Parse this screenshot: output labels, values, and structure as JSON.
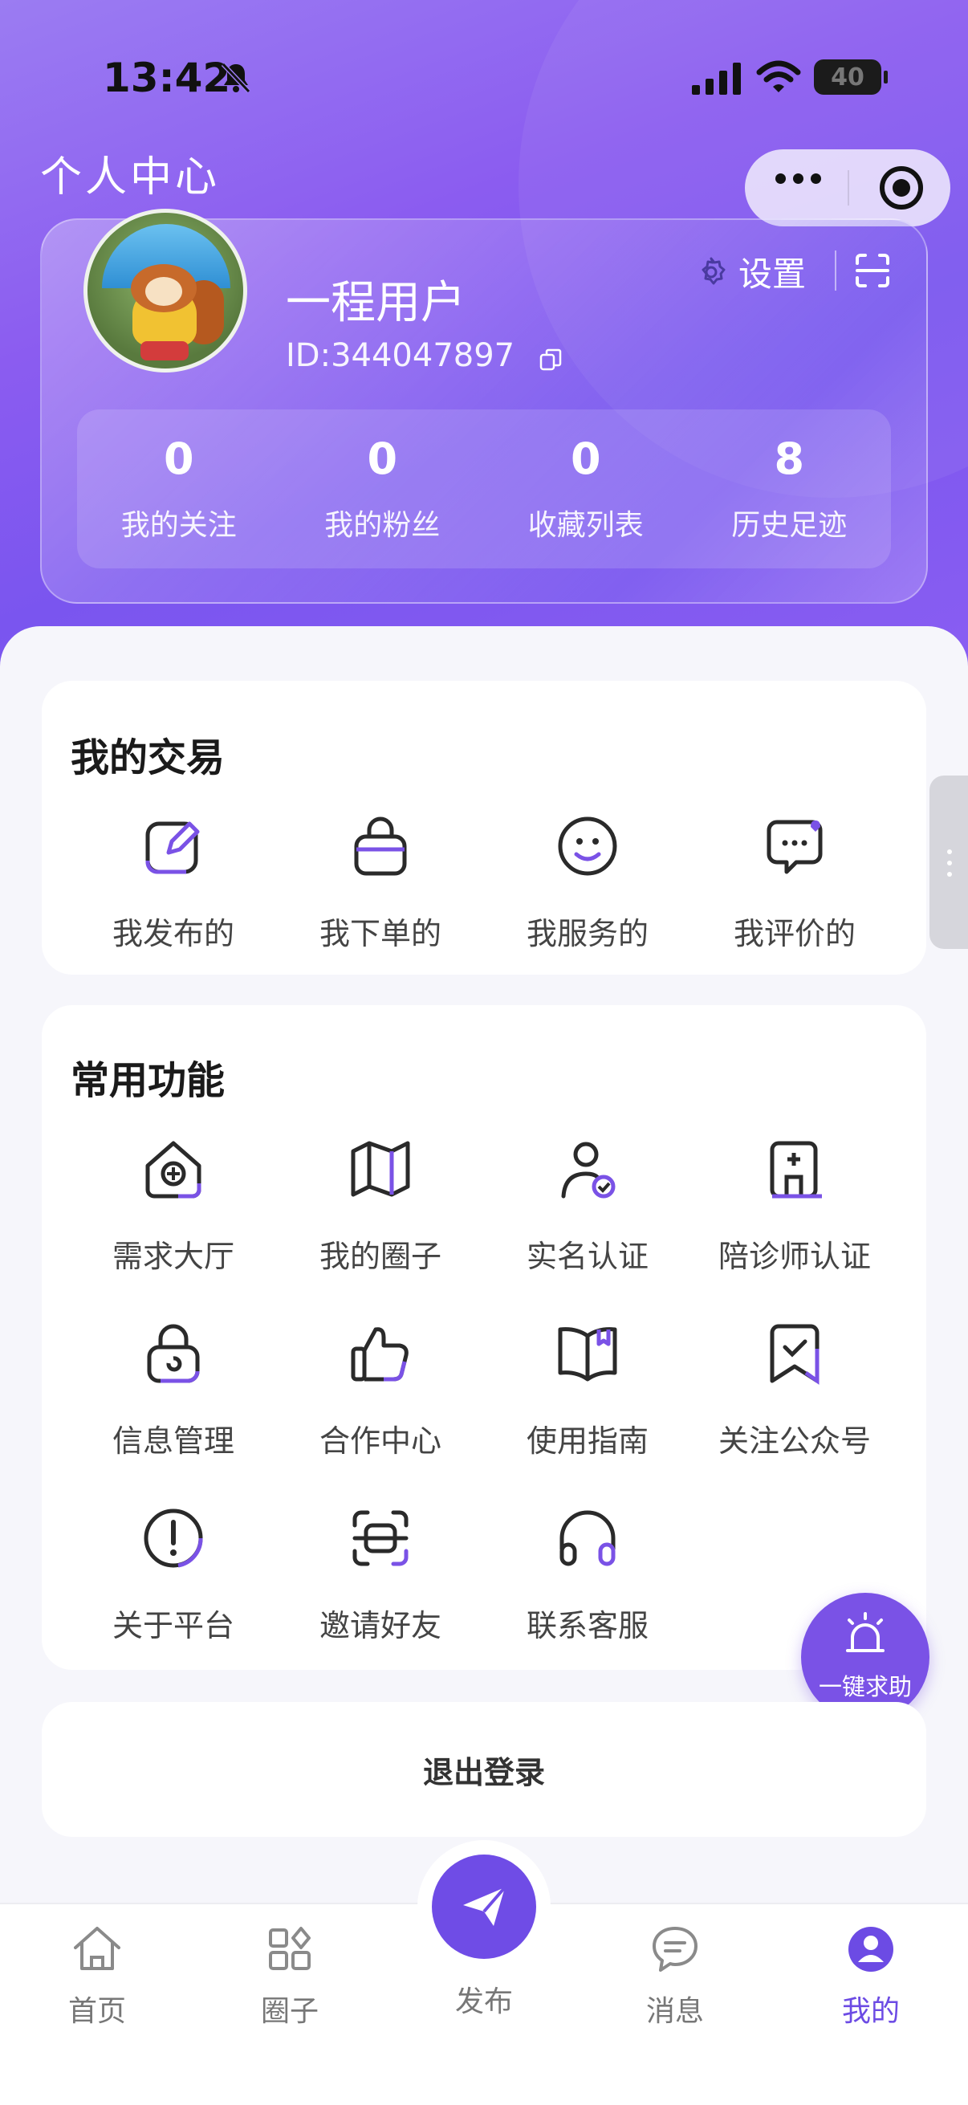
{
  "status_bar": {
    "time": "13:42",
    "battery": "40"
  },
  "header": {
    "title": "个人中心"
  },
  "profile": {
    "username": "一程用户",
    "user_id": "ID:344047897",
    "settings_label": "设置",
    "stats": [
      {
        "value": "0",
        "label": "我的关注"
      },
      {
        "value": "0",
        "label": "我的粉丝"
      },
      {
        "value": "0",
        "label": "收藏列表"
      },
      {
        "value": "8",
        "label": "历史足迹"
      }
    ]
  },
  "transactions": {
    "title": "我的交易",
    "items": [
      {
        "label": "我发布的",
        "icon": "edit-icon"
      },
      {
        "label": "我下单的",
        "icon": "bag-icon"
      },
      {
        "label": "我服务的",
        "icon": "smile-icon"
      },
      {
        "label": "我评价的",
        "icon": "comment-icon"
      }
    ]
  },
  "functions": {
    "title": "常用功能",
    "items": [
      {
        "label": "需求大厅",
        "icon": "house-icon"
      },
      {
        "label": "我的圈子",
        "icon": "map-icon"
      },
      {
        "label": "实名认证",
        "icon": "verified-user-icon"
      },
      {
        "label": "陪诊师认证",
        "icon": "hospital-icon"
      },
      {
        "label": "信息管理",
        "icon": "lock-icon"
      },
      {
        "label": "合作中心",
        "icon": "thumbs-up-icon"
      },
      {
        "label": "使用指南",
        "icon": "book-icon"
      },
      {
        "label": "关注公众号",
        "icon": "bookmark-check-icon"
      },
      {
        "label": "关于平台",
        "icon": "info-icon"
      },
      {
        "label": "邀请好友",
        "icon": "scan-icon"
      },
      {
        "label": "联系客服",
        "icon": "headset-icon"
      }
    ]
  },
  "sos": {
    "label": "一键求助"
  },
  "logout": {
    "label": "退出登录"
  },
  "tabbar": {
    "tabs": [
      {
        "label": "首页",
        "icon": "home-icon"
      },
      {
        "label": "圈子",
        "icon": "grid-icon"
      },
      {
        "label": "发布",
        "icon": "send-icon"
      },
      {
        "label": "消息",
        "icon": "message-icon"
      },
      {
        "label": "我的",
        "icon": "user-icon",
        "active": true
      }
    ]
  },
  "colors": {
    "accent": "#6f4ce6",
    "hero": "#8b5cf0"
  }
}
